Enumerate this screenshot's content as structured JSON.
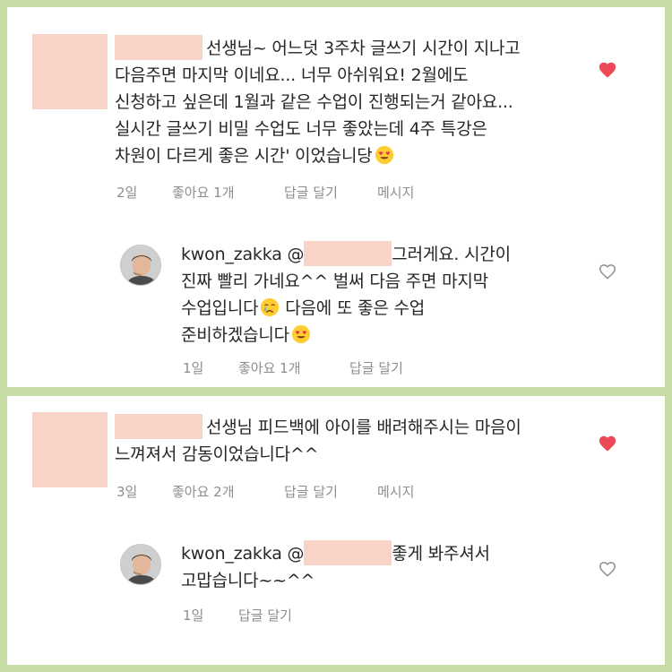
{
  "colors": {
    "background": "#c6dea6",
    "panel": "#ffffff",
    "redaction": "#f8d3c7",
    "heart_liked": "#ed4956",
    "meta_text": "#8e8e8e"
  },
  "comments": [
    {
      "lines": [
        "선생님~ 어느덧 3주차 글쓰기 시간이 지나고",
        "다음주면 마지막 이네요... 너무 아쉬워요! 2월에도",
        "신청하고 싶은데 1월과 같은 수업이 진행되는거 같아요...",
        "실시간 글쓰기 비밀 수업도 너무 좋았는데 4주 특강은",
        "차원이 다르게 좋은 시간' 이었습니당"
      ],
      "emoji": "heart-eyes-emoji",
      "liked": true,
      "meta": {
        "time": "2일",
        "likes": "좋아요 1개",
        "reply": "답글 달기",
        "message": "메시지"
      },
      "reply": {
        "username": "kwon_zakka",
        "at": "@",
        "lines": [
          "그러게요. 시간이",
          "진짜 빨리 가네요^^ 벌써 다음 주면 마지막",
          "수업입니다",
          "다음에 또 좋은 수업",
          "준비하겠습니다"
        ],
        "meta": {
          "time": "1일",
          "likes": "좋아요 1개",
          "reply": "답글 달기"
        }
      }
    },
    {
      "lines": [
        "선생님 피드백에 아이를 배려해주시는 마음이",
        "느껴져서 감동이었습니다^^"
      ],
      "liked": true,
      "meta": {
        "time": "3일",
        "likes": "좋아요 2개",
        "reply": "답글 달기",
        "message": "메시지"
      },
      "reply": {
        "username": "kwon_zakka",
        "at": "@",
        "lines": [
          "좋게 봐주셔서",
          "고맙습니다~~^^"
        ],
        "meta": {
          "time": "1일",
          "reply": "답글 달기"
        }
      }
    }
  ]
}
